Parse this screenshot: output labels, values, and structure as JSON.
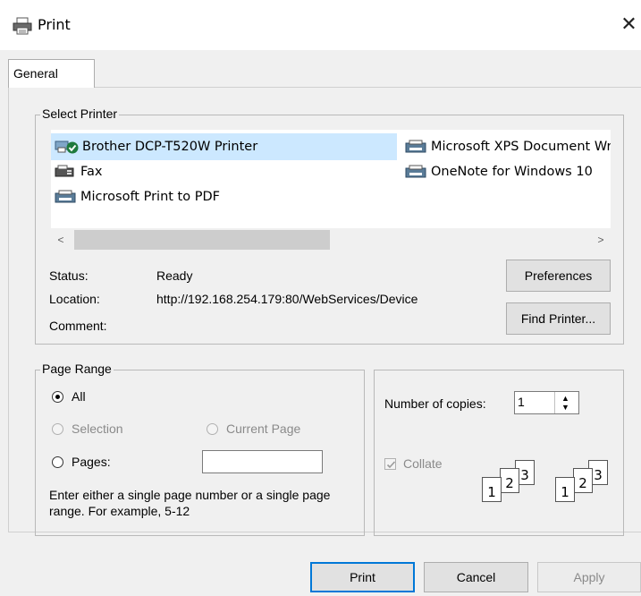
{
  "window": {
    "title": "Print",
    "close_glyph": "✕"
  },
  "tabs": [
    {
      "label": "General",
      "selected": true
    }
  ],
  "select_printer": {
    "legend": "Select Printer",
    "printers": [
      {
        "name": "Brother DCP-T520W Printer",
        "icon": "printer-default-icon",
        "selected": true
      },
      {
        "name": "Fax",
        "icon": "fax-icon"
      },
      {
        "name": "Microsoft Print to PDF",
        "icon": "printer-icon"
      },
      {
        "name": "Microsoft XPS Document Writer",
        "icon": "printer-icon"
      },
      {
        "name": "OneNote for Windows 10",
        "icon": "printer-icon"
      }
    ],
    "scroll_left": "<",
    "scroll_right": ">",
    "status_label": "Status:",
    "status_value": "Ready",
    "location_label": "Location:",
    "location_value": "http://192.168.254.179:80/WebServices/Device",
    "comment_label": "Comment:",
    "preferences_button": "Preferences",
    "find_printer_button": "Find Printer..."
  },
  "page_range": {
    "legend": "Page Range",
    "all_label": "All",
    "selection_label": "Selection",
    "current_page_label": "Current Page",
    "pages_label": "Pages:",
    "pages_value": "",
    "help_text": "Enter either a single page number or a single page range.  For example, 5-12"
  },
  "copies": {
    "label": "Number of copies:",
    "value": "1",
    "spin_up": "▲",
    "spin_down": "▼",
    "collate_label": "Collate",
    "collate_checked": true,
    "collate_enabled": false,
    "collate_pages_a": [
      "1",
      "2",
      "3"
    ],
    "collate_pages_b": [
      "1",
      "2",
      "3"
    ]
  },
  "footer": {
    "print_button": "Print",
    "cancel_button": "Cancel",
    "apply_button": "Apply"
  },
  "colors": {
    "selection_highlight": "#cce8ff",
    "dialog_bg": "#f0f0f0",
    "default_button_border": "#0078d7"
  }
}
